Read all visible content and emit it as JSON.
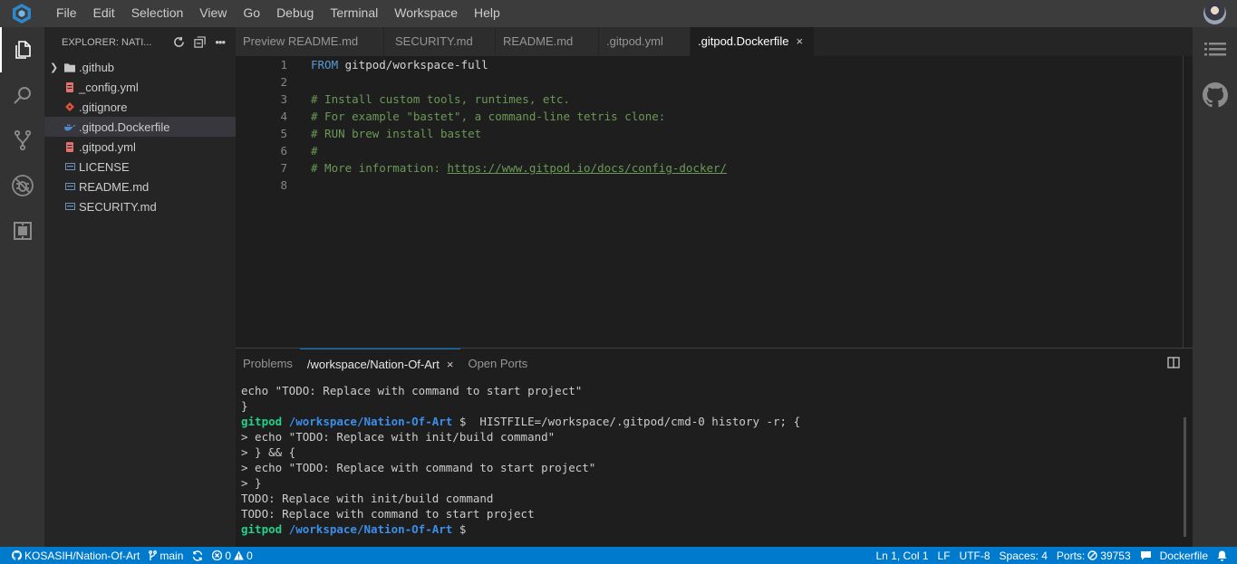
{
  "menu": [
    "File",
    "Edit",
    "Selection",
    "View",
    "Go",
    "Debug",
    "Terminal",
    "Workspace",
    "Help"
  ],
  "explorer": {
    "title": "EXPLORER: NATI...",
    "items": [
      {
        "label": ".github",
        "type": "folder"
      },
      {
        "label": "_config.yml",
        "type": "yml"
      },
      {
        "label": ".gitignore",
        "type": "git"
      },
      {
        "label": ".gitpod.Dockerfile",
        "type": "docker"
      },
      {
        "label": ".gitpod.yml",
        "type": "yml"
      },
      {
        "label": "LICENSE",
        "type": "text"
      },
      {
        "label": "README.md",
        "type": "text"
      },
      {
        "label": "SECURITY.md",
        "type": "text"
      }
    ]
  },
  "tabs": [
    {
      "label": "Preview README.md"
    },
    {
      "label": "SECURITY.md"
    },
    {
      "label": "README.md"
    },
    {
      "label": ".gitpod.yml"
    },
    {
      "label": ".gitpod.Dockerfile",
      "close": "×"
    }
  ],
  "editor": {
    "lines": [
      {
        "n": "1",
        "kw": "FROM",
        "text": " gitpod/workspace-full"
      },
      {
        "n": "2",
        "text": ""
      },
      {
        "n": "3",
        "comment": "# Install custom tools, runtimes, etc."
      },
      {
        "n": "4",
        "comment": "# For example \"bastet\", a command-line tetris clone:"
      },
      {
        "n": "5",
        "comment": "# RUN brew install bastet"
      },
      {
        "n": "6",
        "comment": "#"
      },
      {
        "n": "7",
        "comment": "# More information: ",
        "link": "https://www.gitpod.io/docs/config-docker/"
      },
      {
        "n": "8",
        "text": ""
      }
    ]
  },
  "panel": {
    "tabs": [
      "Problems",
      "/workspace/Nation-Of-Art",
      "Open Ports"
    ],
    "close": "×",
    "terminal": {
      "user": "gitpod",
      "path": "/workspace/Nation-Of-Art",
      "prompt_sym": " $",
      "lines": [
        "echo \"TODO: Replace with command to start project\"",
        "}",
        "  HISTFILE=/workspace/.gitpod/cmd-0 history -r; {",
        "> echo \"TODO: Replace with init/build command\"",
        "> } && {",
        "> echo \"TODO: Replace with command to start project\"",
        "> }",
        "TODO: Replace with init/build command",
        "TODO: Replace with command to start project"
      ]
    }
  },
  "status": {
    "repo": "KOSASIH/Nation-Of-Art",
    "branch": "main",
    "errors": "0",
    "warnings": "0",
    "position": "Ln 1, Col 1",
    "eol": "LF",
    "encoding": "UTF-8",
    "spaces": "Spaces: 4",
    "ports_label": "Ports:",
    "ports": "39753",
    "language": "Dockerfile"
  },
  "colors": {
    "accent": "#007acc",
    "comment": "#6a9955",
    "keyword": "#569cd6",
    "term_green": "#23d18b",
    "term_blue": "#3b8eea"
  }
}
